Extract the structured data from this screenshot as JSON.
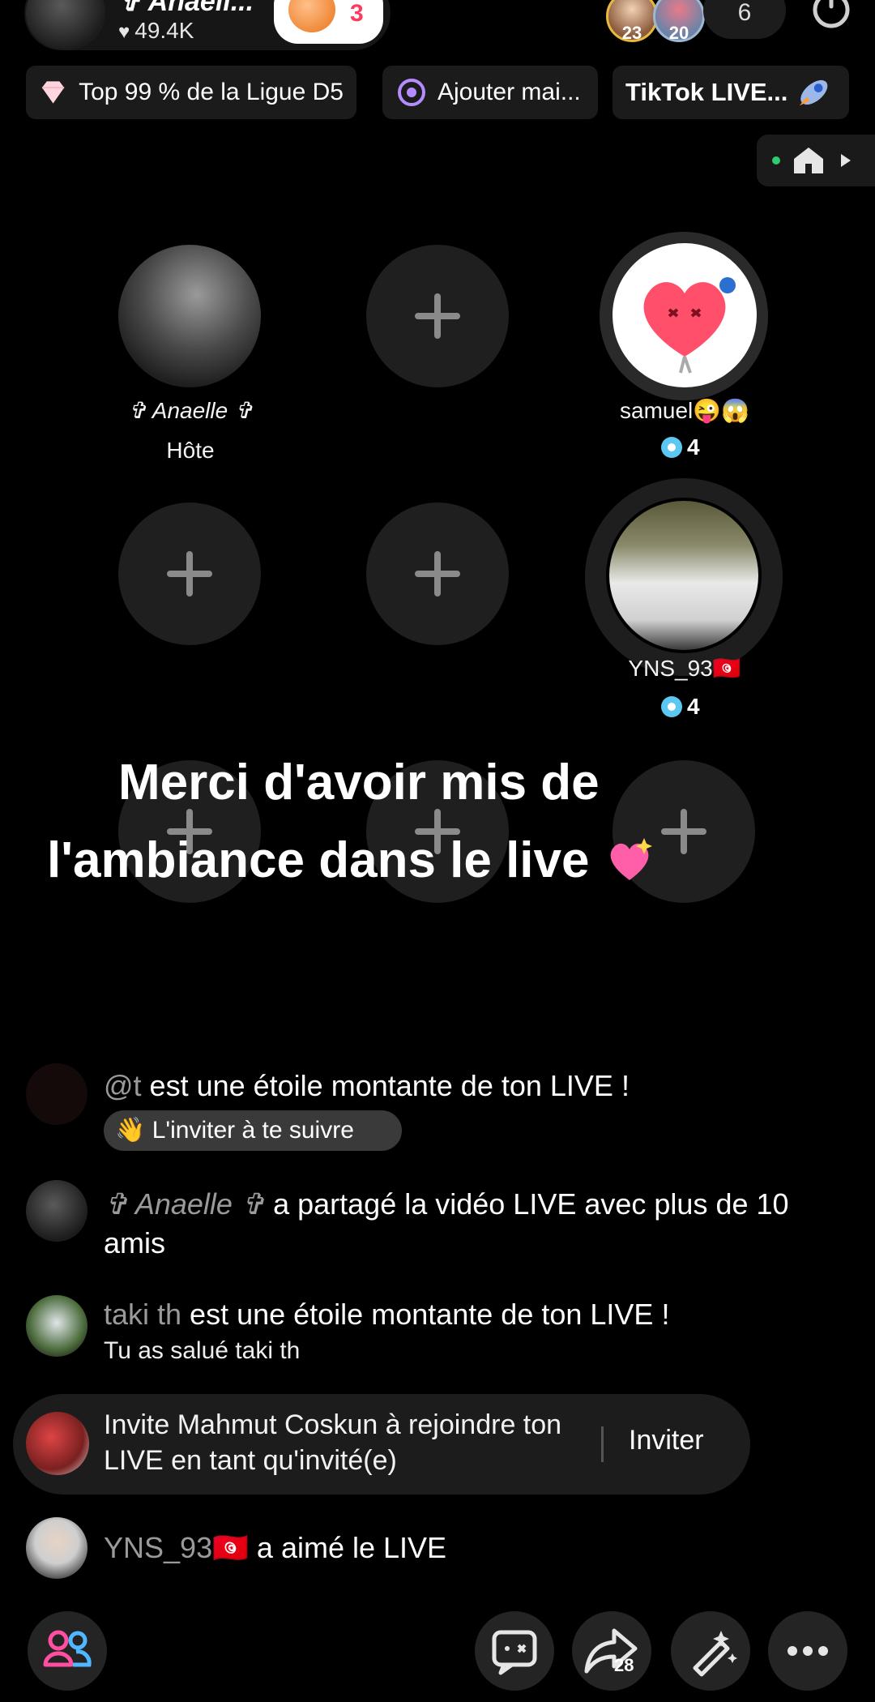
{
  "host": {
    "name": "✞ Anaell...",
    "likes": "49.4K",
    "gift_count": "3"
  },
  "top_right": {
    "viewer_badges": [
      "23",
      "20"
    ],
    "viewer_count": "6"
  },
  "chips": [
    {
      "label": "Top 99 % de la Ligue D5",
      "icon": "diamond-icon"
    },
    {
      "label": "Ajouter mai...",
      "icon": "target-icon"
    },
    {
      "label": "TikTok LIVE...",
      "icon": "rocket-icon"
    }
  ],
  "seats": {
    "host_name": "✞ Anaelle ✞",
    "host_role": "Hôte",
    "guest1_name": "samuel😜😱",
    "guest1_badge": "4",
    "guest2_name": "YNS_93🇹🇳",
    "guest2_badge": "4"
  },
  "caption": {
    "line1": "Merci d'avoir mis de",
    "line2": "l'ambiance dans le live"
  },
  "comments": [
    {
      "user": "@t",
      "text": " est une étoile montante de ton LIVE !",
      "action": "L'inviter à te suivre"
    },
    {
      "user": "✞ Anaelle ✞",
      "text": " a partagé la vidéo LIVE avec plus de 10 amis"
    },
    {
      "user": "taki  th",
      "text": " est une étoile montante de ton LIVE !",
      "sub": "Tu as salué taki  th"
    },
    {
      "user": "YNS_93🇹🇳",
      "text": " a aimé le LIVE"
    }
  ],
  "invite_banner": {
    "text": "Invite Mahmut Coskun à rejoindre ton LIVE en tant qu'invité(e)",
    "button": "Inviter"
  },
  "bottom_bar": {
    "share_count": "28",
    "icons": [
      "people-icon",
      "chat-icon",
      "share-icon",
      "magic-wand-icon",
      "more-icon"
    ]
  },
  "colors": {
    "background": "#000000",
    "muted_text": "#9a9a9a",
    "badge_blue": "#5ac8f0",
    "gift_red": "#ff3a5c",
    "people_icon_pink": "#ff4fa0"
  }
}
